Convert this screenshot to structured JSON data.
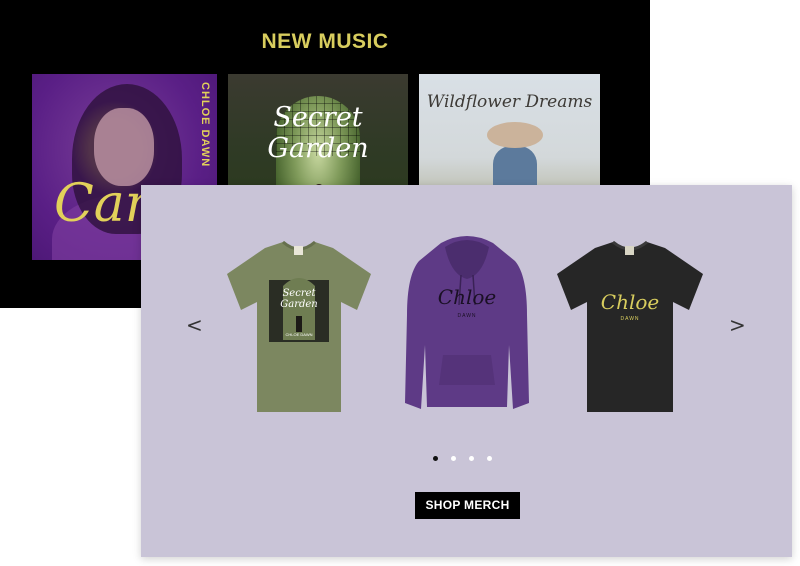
{
  "music": {
    "title": "NEW MUSIC",
    "albums": [
      {
        "script": "Cara",
        "artist": "CHLOE DAWN"
      },
      {
        "script": "Secret Garden"
      },
      {
        "script": "Wildflower Dreams"
      }
    ]
  },
  "merch": {
    "prev_arrow": "<",
    "next_arrow": ">",
    "products": [
      {
        "type": "t-shirt",
        "color": "#7c8760",
        "print": "Secret Garden",
        "print_sub": "CHLOE DAWN"
      },
      {
        "type": "hoodie",
        "color": "#5e3a86",
        "print": "Chloe",
        "print_sub": "DAWN"
      },
      {
        "type": "t-shirt",
        "color": "#262626",
        "print": "Chloe",
        "print_sub": "DAWN"
      }
    ],
    "pagination": {
      "count": 4,
      "active": 0
    },
    "shop_button": "SHOP MERCH"
  },
  "colors": {
    "accent_gold": "#d8cd5e",
    "merch_bg": "#c9c4d7",
    "music_bg": "#000000"
  }
}
